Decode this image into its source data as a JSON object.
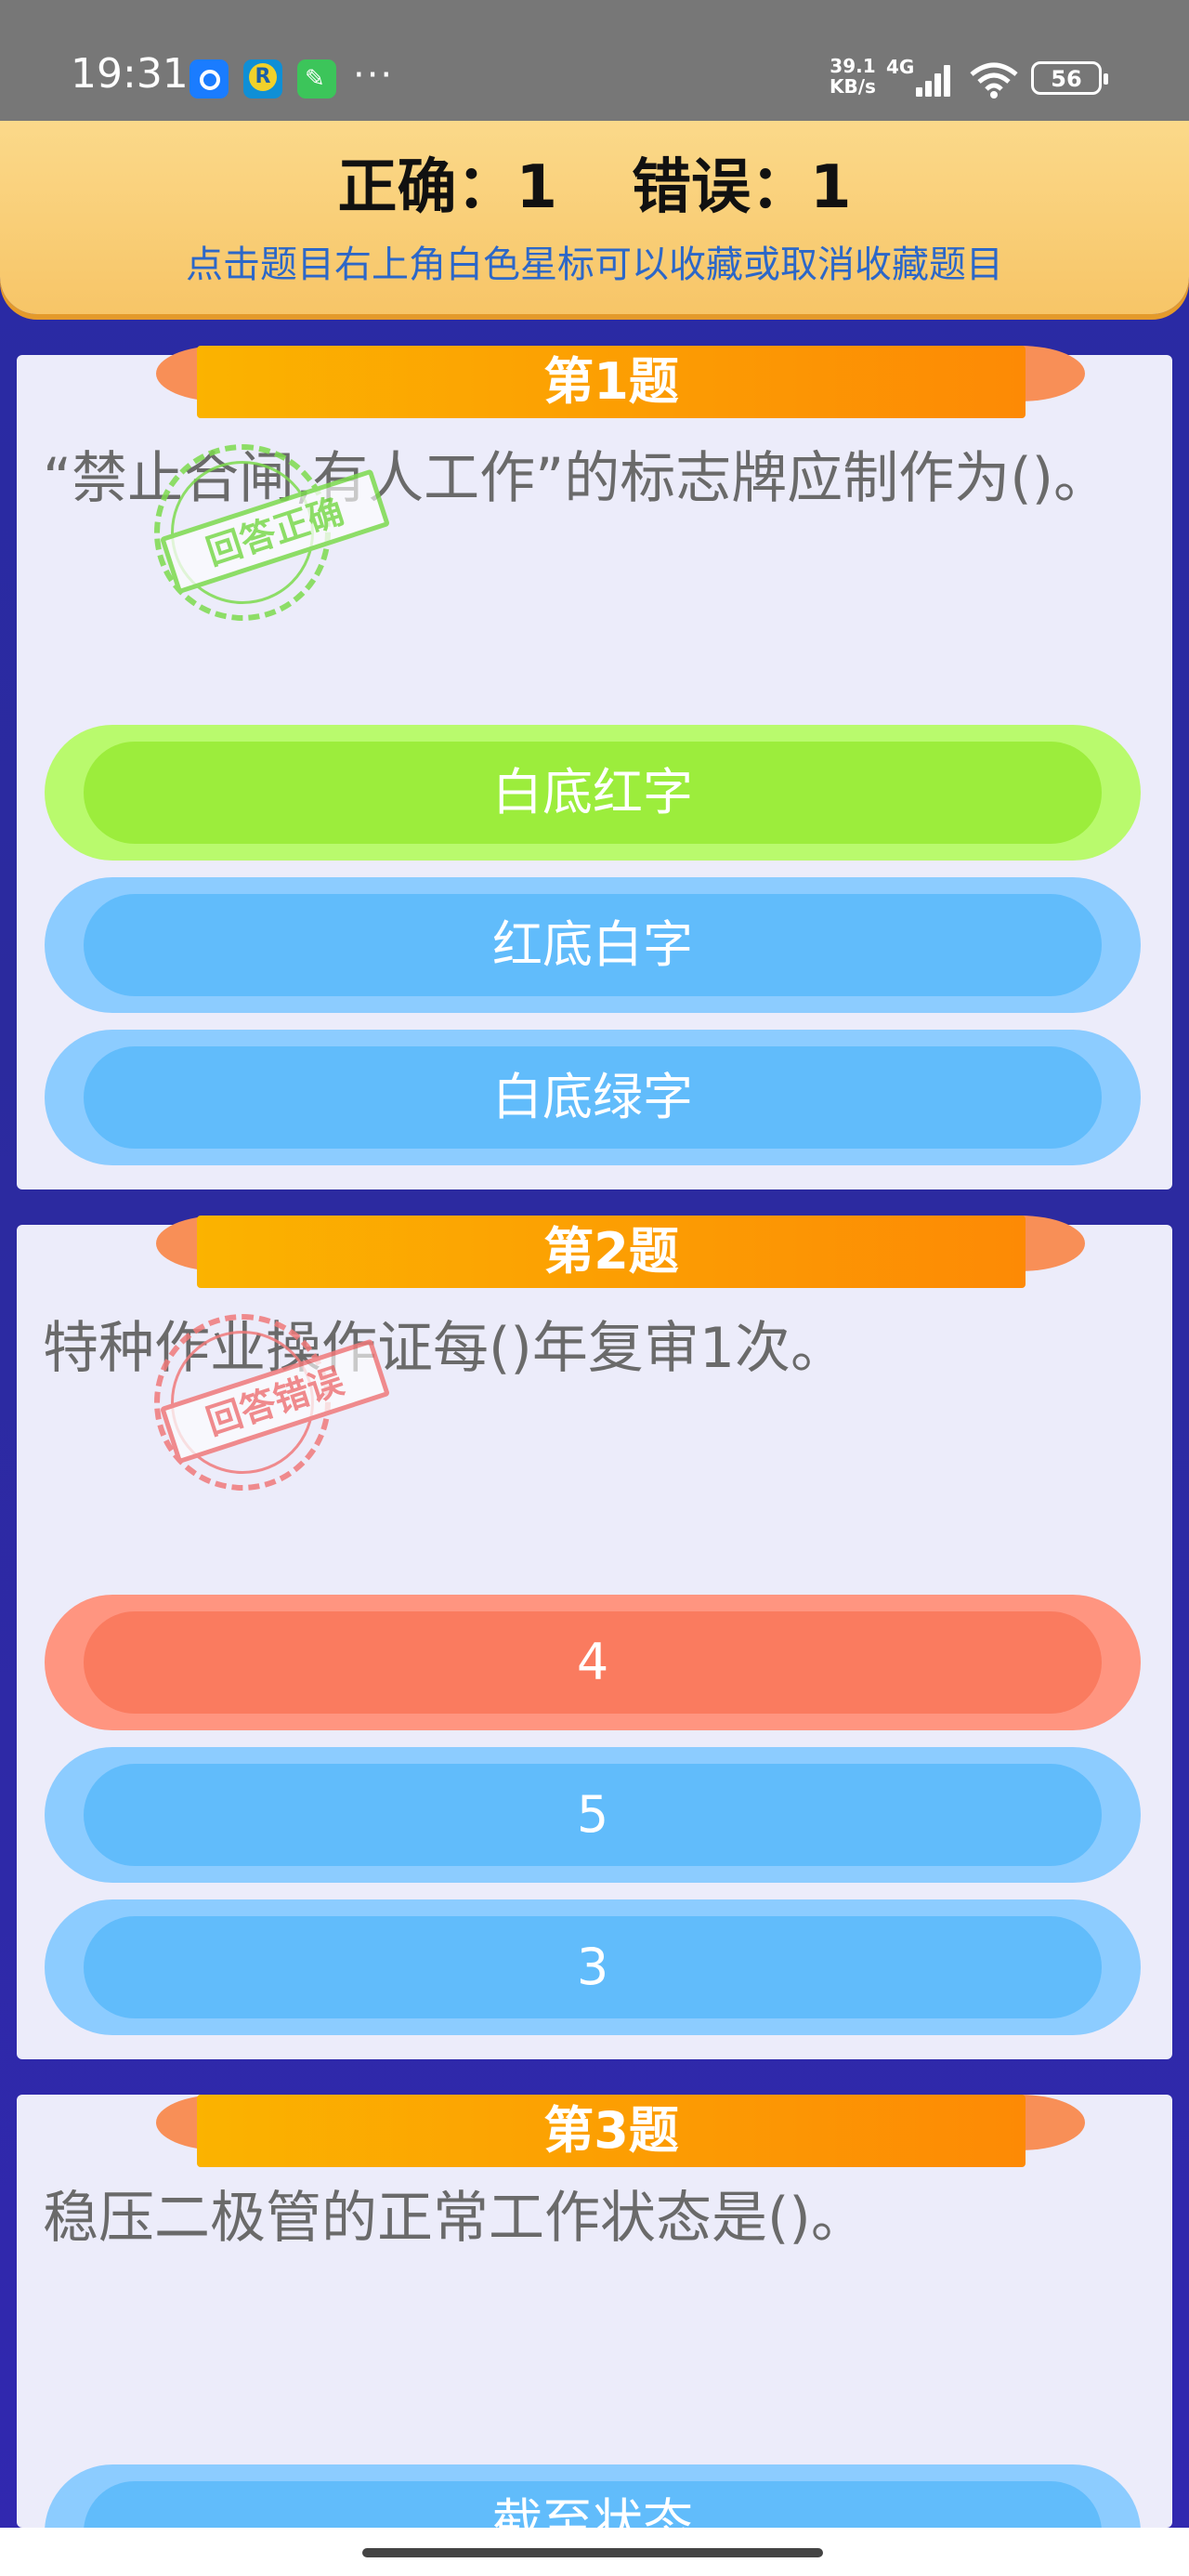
{
  "status": {
    "time": "19:31",
    "more": "···",
    "speed_value": "39.1",
    "speed_unit": "KB/s",
    "network": "4G",
    "battery": "56"
  },
  "header": {
    "correct_label": "正确：1",
    "wrong_label": "错误：1",
    "hint": "点击题目右上角白色星标可以收藏或取消收藏题目"
  },
  "questions": [
    {
      "title": "第1题",
      "text": "“禁止合闸,有人工作”的标志牌应制作为()。",
      "stamp": "回答正确",
      "options": [
        "白底红字",
        "红底白字",
        "白底绿字"
      ]
    },
    {
      "title": "第2题",
      "text": "特种作业操作证每()年复审1次。",
      "stamp": "回答错误",
      "options": [
        "4",
        "5",
        "3"
      ]
    },
    {
      "title": "第3题",
      "text": "稳压二极管的正常工作状态是()。",
      "options": [
        "截至状态"
      ]
    }
  ],
  "colors": {
    "background": "#2b2a9e",
    "correct_option": "#9ced3c",
    "wrong_option": "#fa7b5f",
    "default_option": "#61bcfb",
    "ribbon": "#fd8a05"
  }
}
